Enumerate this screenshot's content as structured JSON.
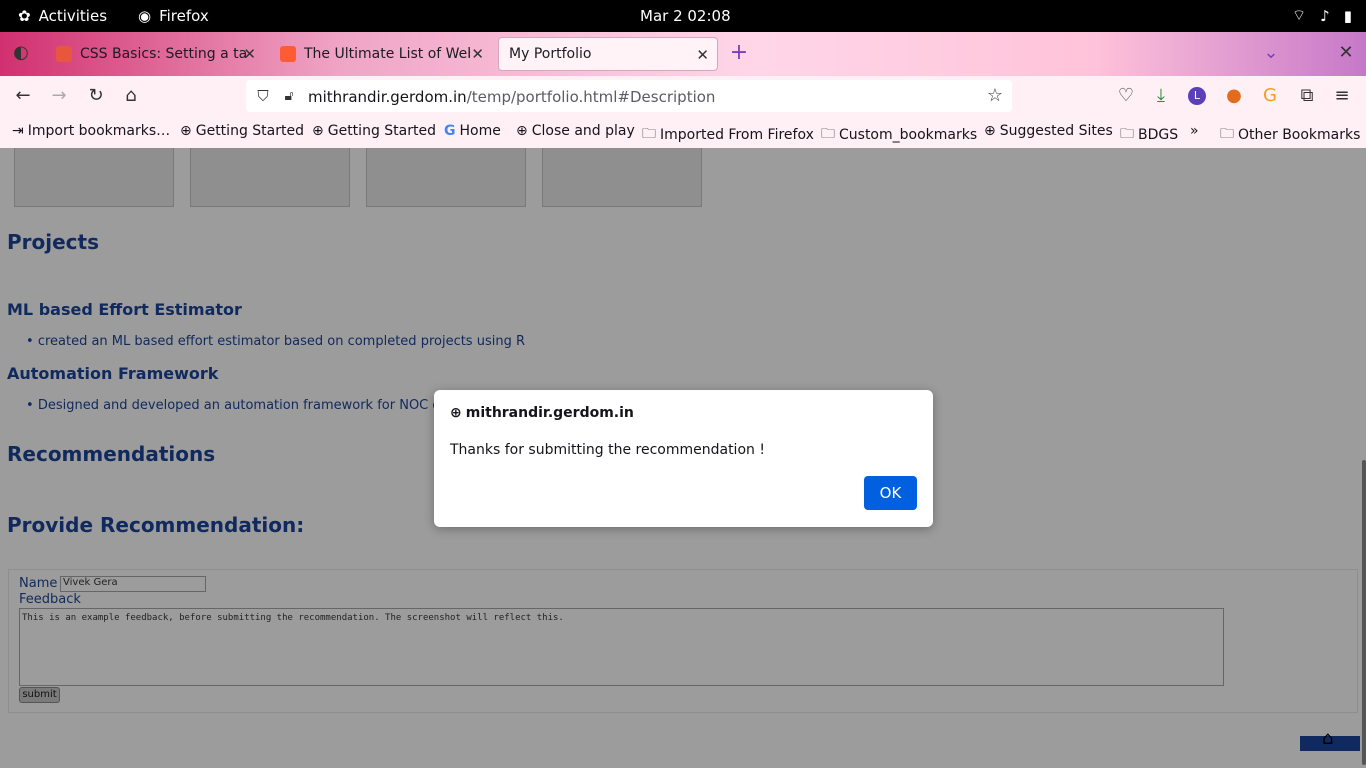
{
  "topbar": {
    "activities": "Activities",
    "app_name": "Firefox",
    "clock": "Mar 2  02:08"
  },
  "tabs": [
    {
      "title": "CSS Basics: Setting a table",
      "favicon_color": "#e8563d"
    },
    {
      "title": "The Ultimate List of Web-",
      "favicon_color": "#ff5c35"
    },
    {
      "title": "My Portfolio",
      "favicon_color": ""
    }
  ],
  "navbar": {
    "url_domain": "mithrandir.gerdom.in",
    "url_path": "/temp/portfolio.html#Description",
    "profile_letter": "L"
  },
  "bookmarks": [
    {
      "label": "Import bookmarks…",
      "icon": "import-icon"
    },
    {
      "label": "Getting Started",
      "icon": "globe-icon"
    },
    {
      "label": "Getting Started",
      "icon": "globe-icon"
    },
    {
      "label": "Home",
      "icon": "google-icon"
    },
    {
      "label": "Close and play",
      "icon": "globe-icon"
    },
    {
      "label": "Imported From Firefox",
      "icon": "folder-icon"
    },
    {
      "label": "Custom_bookmarks",
      "icon": "folder-icon"
    },
    {
      "label": "Suggested Sites",
      "icon": "globe-icon"
    },
    {
      "label": "BDGS",
      "icon": "folder-icon"
    },
    {
      "label": "Other Bookmarks",
      "icon": "folder-icon"
    }
  ],
  "page": {
    "projects_heading": "Projects",
    "project1_title": "ML based Effort Estimator",
    "project1_desc": "created an ML based effort estimator based on completed projects using R",
    "project2_title": "Automation Framework",
    "project2_desc": "Designed and developed an automation framework for NOC o",
    "recommendations_heading": "Recommendations",
    "provide_heading": "Provide Recommendation:",
    "form": {
      "name_label": "Name",
      "name_value": "Vivek Gera",
      "feedback_label": "Feedback",
      "feedback_value": "This is an example feedback, before submitting the recommendation. The screenshot will reflect this.",
      "submit_label": "submit"
    }
  },
  "dialog": {
    "origin": "mithrandir.gerdom.in",
    "message": "Thanks for submitting the recommendation !",
    "ok_label": "OK"
  }
}
